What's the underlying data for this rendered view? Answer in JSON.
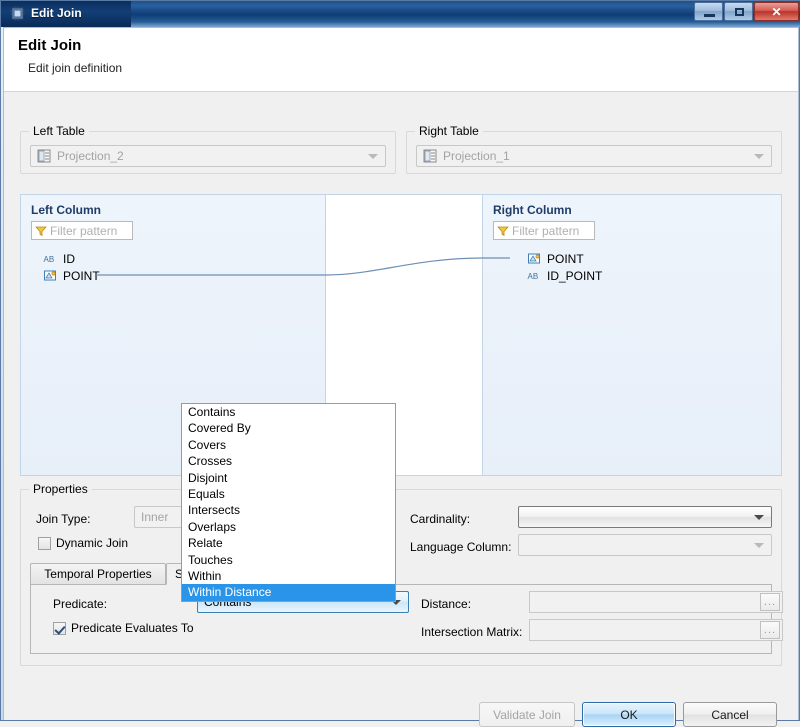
{
  "window": {
    "title": "Edit Join",
    "icon": "chip-icon",
    "controls": {
      "minimize": "minimize-icon",
      "maximize": "maximize-icon",
      "close": "✕"
    }
  },
  "header": {
    "title": "Edit Join",
    "subtitle": "Edit join definition"
  },
  "left_table": {
    "group_label": "Left Table",
    "value": "Projection_2",
    "icon": "table-icon",
    "enabled": false
  },
  "right_table": {
    "group_label": "Right Table",
    "value": "Projection_1",
    "icon": "table-icon",
    "enabled": false
  },
  "left_column": {
    "title": "Left Column",
    "filter_placeholder": "Filter pattern",
    "filter_value": "",
    "items": [
      {
        "label": "ID",
        "icon": "ab-text-icon"
      },
      {
        "label": "POINT",
        "icon": "spatial-geometry-icon"
      }
    ]
  },
  "right_column": {
    "title": "Right Column",
    "filter_placeholder": "Filter pattern",
    "filter_value": "",
    "items": [
      {
        "label": "POINT",
        "icon": "spatial-geometry-icon"
      },
      {
        "label": "ID_POINT",
        "icon": "ab-text-icon"
      }
    ]
  },
  "properties": {
    "group_label": "Properties",
    "join_type_label": "Join Type:",
    "join_type_value": "Inner",
    "dynamic_join_label": "Dynamic Join",
    "dynamic_join_checked": false,
    "cardinality_label": "Cardinality:",
    "cardinality_value": "",
    "language_column_label": "Language Column:",
    "language_column_value": ""
  },
  "tabs": [
    {
      "label": "Temporal Properties",
      "active": false
    },
    {
      "label": "Spatial Properties",
      "active": true
    }
  ],
  "spatial_tab": {
    "predicate_label": "Predicate:",
    "predicate_value": "Contains",
    "predicate_evaluates_label": "Predicate Evaluates To",
    "predicate_evaluates_checked": true,
    "distance_label": "Distance:",
    "distance_value": "",
    "intersection_matrix_label": "Intersection Matrix:",
    "intersection_matrix_value": "",
    "browse_label": "..."
  },
  "predicate_dropdown": {
    "open": true,
    "selected": "Within Distance",
    "options": [
      "Contains",
      "Covered By",
      "Covers",
      "Crosses",
      "Disjoint",
      "Equals",
      "Intersects",
      "Overlaps",
      "Relate",
      "Touches",
      "Within",
      "Within Distance"
    ]
  },
  "footer": {
    "validate_label": "Validate Join",
    "ok_label": "OK",
    "cancel_label": "Cancel"
  },
  "colors": {
    "title_blue": "#0f3c74",
    "panel_header_text": "#1f3c66",
    "selection_blue": "#2a95e8",
    "close_red": "#b8332a",
    "connector": "#6d8fb3"
  }
}
